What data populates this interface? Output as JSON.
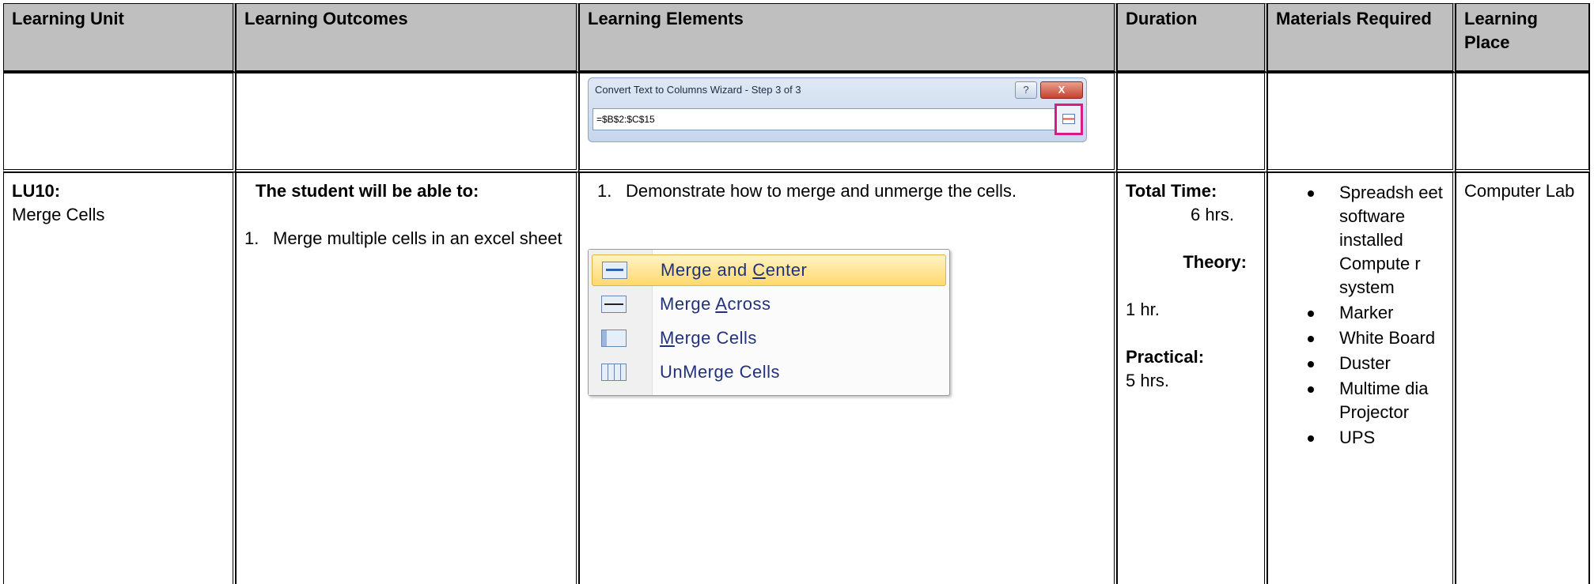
{
  "headers": {
    "learning_unit": "Learning Unit",
    "learning_outcomes": "Learning Outcomes",
    "learning_elements": "Learning Elements",
    "duration": "Duration",
    "materials_required": "Materials Required",
    "learning_place": "Learning Place"
  },
  "row1": {
    "dialog": {
      "title": "Convert Text to Columns Wizard - Step 3 of 3",
      "help_glyph": "?",
      "close_glyph": "X",
      "reference_value": "=$B$2:$C$15"
    }
  },
  "row2": {
    "unit_code": "LU10:",
    "unit_name": "Merge Cells",
    "outcomes_intro": "The student will be able to:",
    "outcome_1_num": "1.",
    "outcome_1_text": "Merge multiple cells in an excel sheet",
    "element_1_num": "1.",
    "element_1_text": "Demonstrate how to merge and unmerge the cells.",
    "merge_menu": {
      "item_1_pre": "Merge and ",
      "item_1_key": "C",
      "item_1_post": "enter",
      "item_2_pre": "Merge ",
      "item_2_key": "A",
      "item_2_post": "cross",
      "item_3_key": "M",
      "item_3_post": "erge Cells",
      "item_4": "UnMerge Cells"
    },
    "duration": {
      "total_label": "Total Time:",
      "total_value": "6 hrs.",
      "theory_label": "Theory:",
      "theory_value": "1 hr.",
      "practical_label": "Practical:",
      "practical_value": "5 hrs."
    },
    "materials": [
      "Spreadsh eet software installed Compute r system",
      "Marker",
      "White Board",
      "Duster",
      "Multime dia Projector",
      "UPS"
    ],
    "place": "Computer Lab"
  }
}
